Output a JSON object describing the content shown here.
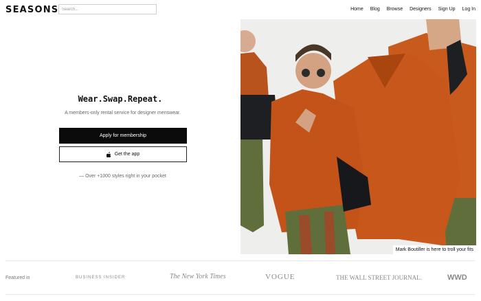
{
  "header": {
    "logo": "SEASONS",
    "search_placeholder": "Search...",
    "nav": [
      "Home",
      "Blog",
      "Browse",
      "Designers",
      "Sign Up",
      "Log In"
    ]
  },
  "hero": {
    "tagline": "Wear.Swap.Repeat.",
    "subtitle": "A members-only rental service for designer menswear.",
    "primary_button": "Apply for membership",
    "secondary_button": "Get the app",
    "footnote": "— Over +1000 styles right in your pocket",
    "photo_caption": "Mark Boutiller is here to troll your fits"
  },
  "featured": {
    "label": "Featured in",
    "press": [
      "BUSINESS INSIDER",
      "The New York Times",
      "VOGUE",
      "THE WALL STREET JOURNAL.",
      "WWD"
    ]
  },
  "colors": {
    "jacket": "#c4561c",
    "trousers": "#5f6e3a",
    "button_dark": "#0b0b0b"
  }
}
